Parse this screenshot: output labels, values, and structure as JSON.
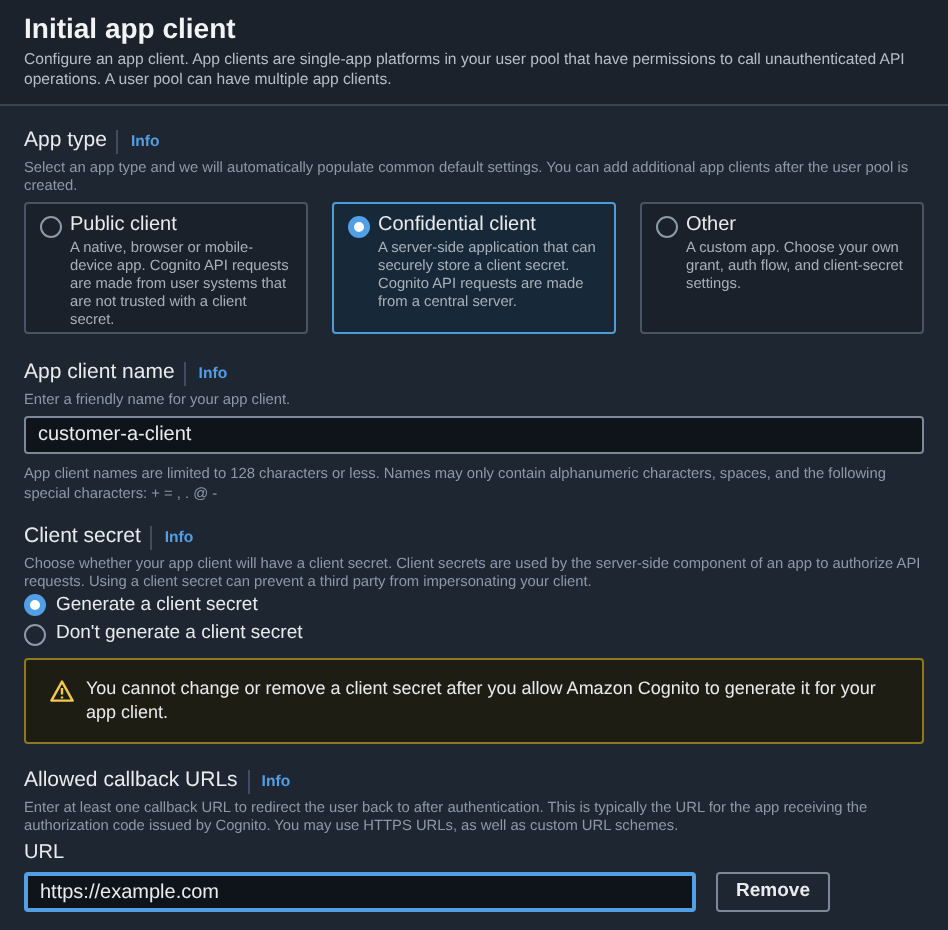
{
  "header": {
    "title": "Initial app client",
    "description": "Configure an app client. App clients are single-app platforms in your user pool that have permissions to call unauthenticated API operations. A user pool can have multiple app clients."
  },
  "app_type": {
    "label": "App type",
    "info": "Info",
    "description": "Select an app type and we will automatically populate common default settings. You can add additional app clients after the user pool is created.",
    "options": [
      {
        "title": "Public client",
        "description": "A native, browser or mobile-device app. Cognito API requests are made from user systems that are not trusted with a client secret.",
        "selected": false
      },
      {
        "title": "Confidential client",
        "description": "A server-side application that can securely store a client secret. Cognito API requests are made from a central server.",
        "selected": true
      },
      {
        "title": "Other",
        "description": "A custom app. Choose your own grant, auth flow, and client-secret settings.",
        "selected": false
      }
    ]
  },
  "app_client_name": {
    "label": "App client name",
    "info": "Info",
    "description": "Enter a friendly name for your app client.",
    "value": "customer-a-client",
    "constraint": "App client names are limited to 128 characters or less. Names may only contain alphanumeric characters, spaces, and the following special characters: + = , . @ -"
  },
  "client_secret": {
    "label": "Client secret",
    "info": "Info",
    "description": "Choose whether your app client will have a client secret. Client secrets are used by the server-side component of an app to authorize API requests. Using a client secret can prevent a third party from impersonating your client.",
    "options": [
      {
        "label": "Generate a client secret",
        "selected": true
      },
      {
        "label": "Don't generate a client secret",
        "selected": false
      }
    ],
    "warning": "You cannot change or remove a client secret after you allow Amazon Cognito to generate it for your app client."
  },
  "callback_urls": {
    "label": "Allowed callback URLs",
    "info": "Info",
    "description": "Enter at least one callback URL to redirect the user back to after authentication. This is typically the URL for the app receiving the authorization code issued by Cognito. You may use HTTPS URLs, as well as custom URL schemes.",
    "url_label": "URL",
    "url_value": "https://example.com",
    "remove_button": "Remove"
  }
}
